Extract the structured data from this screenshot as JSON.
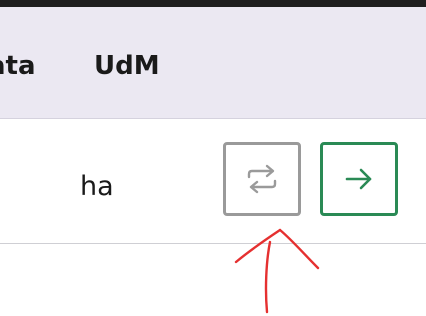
{
  "table": {
    "header": {
      "partial_column_label": "ata",
      "unit_column_label": "UdM"
    },
    "rows": [
      {
        "unit": "ha"
      }
    ]
  },
  "actions": {
    "swap_icon": "swap-arrows-icon",
    "next_icon": "arrow-right-icon"
  },
  "colors": {
    "header_bg": "#ebe8f2",
    "swap_border": "#9a9a9a",
    "next_border": "#2a8a55",
    "annotation": "#e53030"
  }
}
